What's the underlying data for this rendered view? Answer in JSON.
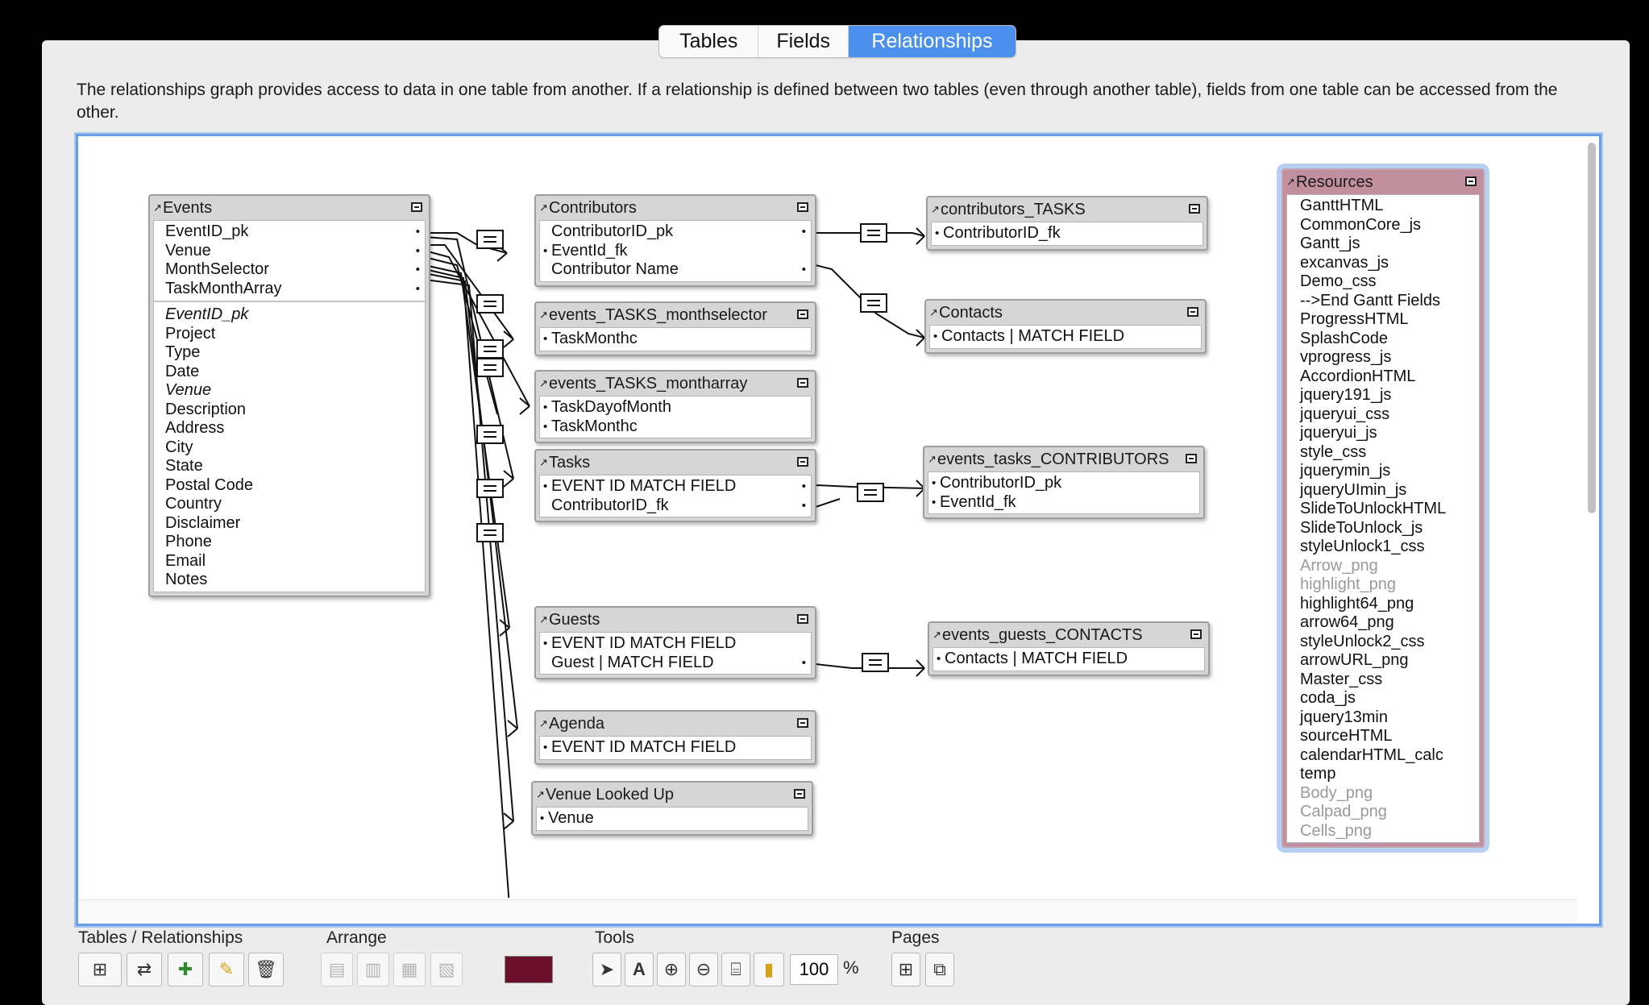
{
  "tabs": [
    "Tables",
    "Fields",
    "Relationships"
  ],
  "active_tab": "Relationships",
  "description": "The relationships graph provides access to data in one table from another. If a relationship is defined between two tables (even through another table), fields from one table can be accessed from the other.",
  "tables": {
    "events": {
      "name": "Events",
      "match_fields": [
        "EventID_pk",
        "Venue",
        "MonthSelector",
        "TaskMonthArray"
      ],
      "fields": [
        "EventID_pk",
        "Project",
        "Type",
        "Date",
        "Venue",
        "Description",
        "Address",
        "City",
        "State",
        "Postal Code",
        "Country",
        "Disclaimer",
        "Phone",
        "Email",
        "Notes"
      ]
    },
    "contributors": {
      "name": "Contributors",
      "fields": [
        "ContributorID_pk",
        "EventId_fk",
        "Contributor Name"
      ]
    },
    "monthselector": {
      "name": "events_TASKS_monthselector",
      "fields": [
        "TaskMonthc"
      ]
    },
    "montharray": {
      "name": "events_TASKS_montharray",
      "fields": [
        "TaskDayofMonth",
        "TaskMonthc"
      ]
    },
    "tasks": {
      "name": "Tasks",
      "fields": [
        "EVENT ID MATCH FIELD",
        "ContributorID_fk"
      ]
    },
    "guests": {
      "name": "Guests",
      "fields": [
        "EVENT ID MATCH FIELD",
        "Guest | MATCH FIELD"
      ]
    },
    "agenda": {
      "name": "Agenda",
      "fields": [
        "EVENT ID MATCH FIELD"
      ]
    },
    "venue": {
      "name": "Venue Looked Up",
      "fields": [
        "Venue"
      ]
    },
    "contributors_tasks": {
      "name": "contributors_TASKS",
      "fields": [
        "ContributorID_fk"
      ]
    },
    "contacts": {
      "name": "Contacts",
      "fields": [
        "Contacts | MATCH FIELD"
      ]
    },
    "tasks_contributors": {
      "name": "events_tasks_CONTRIBUTORS",
      "fields": [
        "ContributorID_pk",
        "EventId_fk"
      ]
    },
    "guests_contacts": {
      "name": "events_guests_CONTACTS",
      "fields": [
        "Contacts | MATCH FIELD"
      ]
    },
    "resources": {
      "name": "Resources",
      "fields": [
        "GanttHTML",
        "CommonCore_js",
        "Gantt_js",
        "excanvas_js",
        "Demo_css",
        "-->End Gantt Fields",
        "ProgressHTML",
        "SplashCode",
        "vprogress_js",
        "AccordionHTML",
        "jquery191_js",
        "jqueryui_css",
        "jqueryui_js",
        "style_css",
        "jquerymin_js",
        "jqueryUImin_js",
        "SlideToUnlockHTML",
        "SlideToUnlock_js",
        "styleUnlock1_css",
        "Arrow_png",
        "highlight_png",
        "highlight64_png",
        "arrow64_png",
        "styleUnlock2_css",
        "arrowURL_png",
        "Master_css",
        "coda_js",
        "jquery13min",
        "sourceHTML",
        "calendarHTML_calc",
        "temp",
        "Body_png",
        "Calpad_png",
        "Cells_png"
      ],
      "color": "#c28f9f"
    }
  },
  "bottom": {
    "groups": [
      "Tables / Relationships",
      "Arrange",
      "Tools",
      "Pages"
    ],
    "zoom": "100",
    "zoom_unit": "%",
    "swatch_color": "#6b0f2b"
  },
  "colors": {
    "accent": "#4a90ec",
    "graph_border": "#6b9fe3"
  }
}
